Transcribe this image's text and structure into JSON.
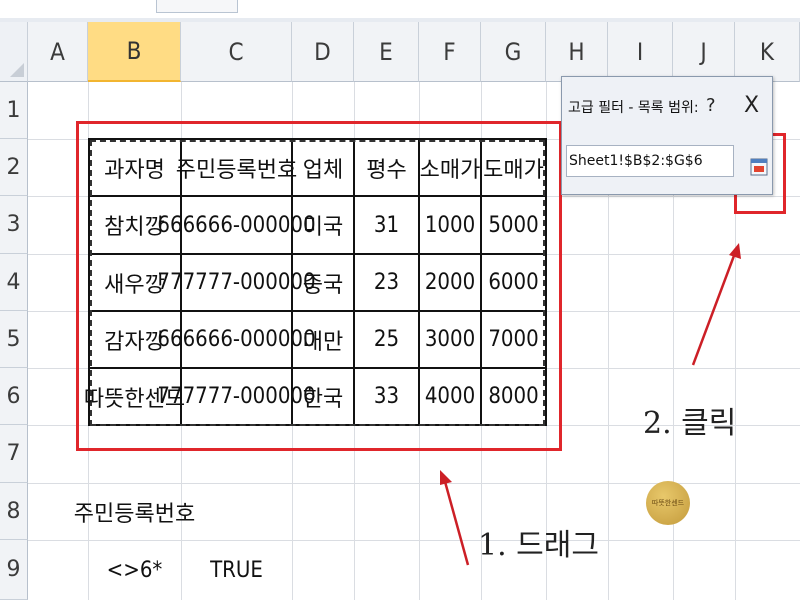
{
  "columns": [
    "A",
    "B",
    "C",
    "D",
    "E",
    "F",
    "G",
    "H",
    "I",
    "J",
    "K"
  ],
  "rows": [
    "1",
    "2",
    "3",
    "4",
    "5",
    "6",
    "7",
    "8",
    "9"
  ],
  "table": {
    "headers": [
      "과자명",
      "주민등록번호",
      "업체",
      "평수",
      "소매가",
      "도매가"
    ],
    "rows": [
      [
        "참치깡",
        "666666-000000",
        "미국",
        "31",
        "1000",
        "5000"
      ],
      [
        "새우깡",
        "777777-000000",
        "중국",
        "23",
        "2000",
        "6000"
      ],
      [
        "감자깡",
        "666666-000000",
        "대만",
        "25",
        "3000",
        "7000"
      ],
      [
        "따뜻한센드",
        "777777-000000",
        "한국",
        "33",
        "4000",
        "8000"
      ]
    ]
  },
  "criteria": {
    "header": "주민등록번호",
    "value": "<>6*",
    "value2": "TRUE"
  },
  "dialog": {
    "title": "고급 필터 - 목록 범위:",
    "help": "?",
    "close": "X",
    "range_value": "Sheet1!$B$2:$G$6"
  },
  "annotations": {
    "drag": "1. 드래그",
    "click": "2. 클릭"
  },
  "badge_text": "따뜻한센드",
  "colors": {
    "highlight_red": "#e0262b",
    "selected_col": "#ffdc84"
  }
}
